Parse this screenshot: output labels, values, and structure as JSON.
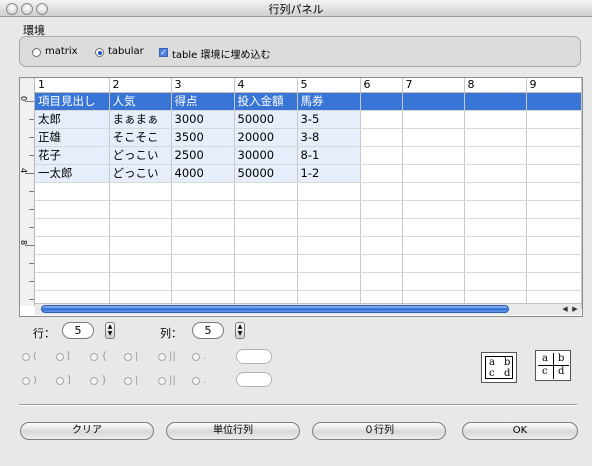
{
  "window": {
    "title": "行列パネル"
  },
  "environment": {
    "label": "環境",
    "options": [
      "matrix",
      "tabular",
      "table 環境に埋め込む"
    ],
    "selected": "tabular",
    "embed_checked": true
  },
  "grid": {
    "column_headers": [
      "1",
      "2",
      "3",
      "4",
      "5",
      "6",
      "7",
      "8",
      "9"
    ],
    "row_ruler": [
      "0",
      "4",
      "8"
    ],
    "rows": [
      [
        "項目見出し",
        "人気",
        "得点",
        "投入金額",
        "馬券",
        "",
        "",
        "",
        ""
      ],
      [
        "太郎",
        "まぁまぁ",
        "3000",
        "50000",
        "3-5",
        "",
        "",
        "",
        ""
      ],
      [
        "正雄",
        "そこそこ",
        "3500",
        "20000",
        "3-8",
        "",
        "",
        "",
        ""
      ],
      [
        "花子",
        "どっこい",
        "2500",
        "30000",
        "8-1",
        "",
        "",
        "",
        ""
      ],
      [
        "一太郎",
        "どっこい",
        "4000",
        "50000",
        "1-2",
        "",
        "",
        "",
        ""
      ],
      [
        "",
        "",
        "",
        "",
        "",
        "",
        "",
        "",
        ""
      ],
      [
        "",
        "",
        "",
        "",
        "",
        "",
        "",
        "",
        ""
      ],
      [
        "",
        "",
        "",
        "",
        "",
        "",
        "",
        "",
        ""
      ],
      [
        "",
        "",
        "",
        "",
        "",
        "",
        "",
        "",
        ""
      ],
      [
        "",
        "",
        "",
        "",
        "",
        "",
        "",
        "",
        ""
      ],
      [
        "",
        "",
        "",
        "",
        "",
        "",
        "",
        "",
        ""
      ],
      [
        "",
        "",
        "",
        "",
        "",
        "",
        "",
        "",
        ""
      ]
    ],
    "selected_row": 0,
    "filled_rows": 5,
    "filled_cols": 5
  },
  "dims": {
    "rows_label": "行：",
    "rows_value": "5",
    "cols_label": "列：",
    "cols_value": "5"
  },
  "delimiters": {
    "left": [
      "(",
      "[",
      "{",
      "|",
      "||",
      "."
    ],
    "right": [
      ")",
      "]",
      "}",
      "|",
      "||",
      "."
    ]
  },
  "previews": [
    {
      "cells": [
        "a",
        "b",
        "c",
        "d"
      ],
      "style": "boxed"
    },
    {
      "cells": [
        "a",
        "b",
        "c",
        "d"
      ],
      "style": "lined"
    }
  ],
  "buttons": {
    "clear": "クリア",
    "unit": "単位行列",
    "zero": "０行列",
    "ok": "OK"
  },
  "icons": {
    "close": "close-icon",
    "minimize": "minimize-icon",
    "zoom": "zoom-icon",
    "stepper": "stepper-arrows-icon",
    "scroll_left": "arrow-left-icon",
    "scroll_right": "arrow-right-icon"
  }
}
